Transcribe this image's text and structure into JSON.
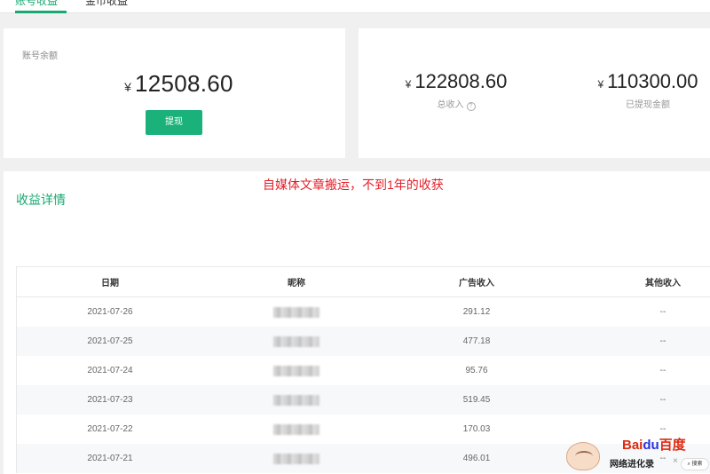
{
  "tabs": [
    {
      "label": "账号收益",
      "active": true
    },
    {
      "label": "金币收益",
      "active": false
    }
  ],
  "balance": {
    "label": "账号余额",
    "currency": "¥",
    "amount": "12508.60",
    "withdraw_label": "提现"
  },
  "totals": [
    {
      "currency": "¥",
      "amount": "122808.60",
      "label": "总收入",
      "has_help": true
    },
    {
      "currency": "¥",
      "amount": "110300.00",
      "label": "已提现金额",
      "has_help": false
    }
  ],
  "detail": {
    "title": "收益详情",
    "annotation": "自媒体文章搬运，不到1年的收获",
    "columns": [
      "日期",
      "昵称",
      "广告收入",
      "其他收入"
    ],
    "rows": [
      {
        "date": "2021-07-26",
        "nickname_redacted": true,
        "ad_income": "291.12",
        "other_income": "--"
      },
      {
        "date": "2021-07-25",
        "nickname_redacted": true,
        "ad_income": "477.18",
        "other_income": "--"
      },
      {
        "date": "2021-07-24",
        "nickname_redacted": true,
        "ad_income": "95.76",
        "other_income": "--"
      },
      {
        "date": "2021-07-23",
        "nickname_redacted": true,
        "ad_income": "519.45",
        "other_income": "--"
      },
      {
        "date": "2021-07-22",
        "nickname_redacted": true,
        "ad_income": "170.03",
        "other_income": "--"
      },
      {
        "date": "2021-07-21",
        "nickname_redacted": true,
        "ad_income": "496.01",
        "other_income": "--"
      }
    ]
  },
  "watermark": {
    "brand_left": "Bai",
    "brand_mid": "du",
    "brand_right": "百度",
    "subtitle": "网络进化录",
    "search_label": "搜索",
    "close": "×",
    "mascot_icon": "mascot-icon"
  },
  "colors": {
    "accent": "#17a873",
    "button": "#1ab17b",
    "annotation": "#e5202a",
    "baidu_red": "#de2910",
    "baidu_blue": "#2932e1"
  }
}
